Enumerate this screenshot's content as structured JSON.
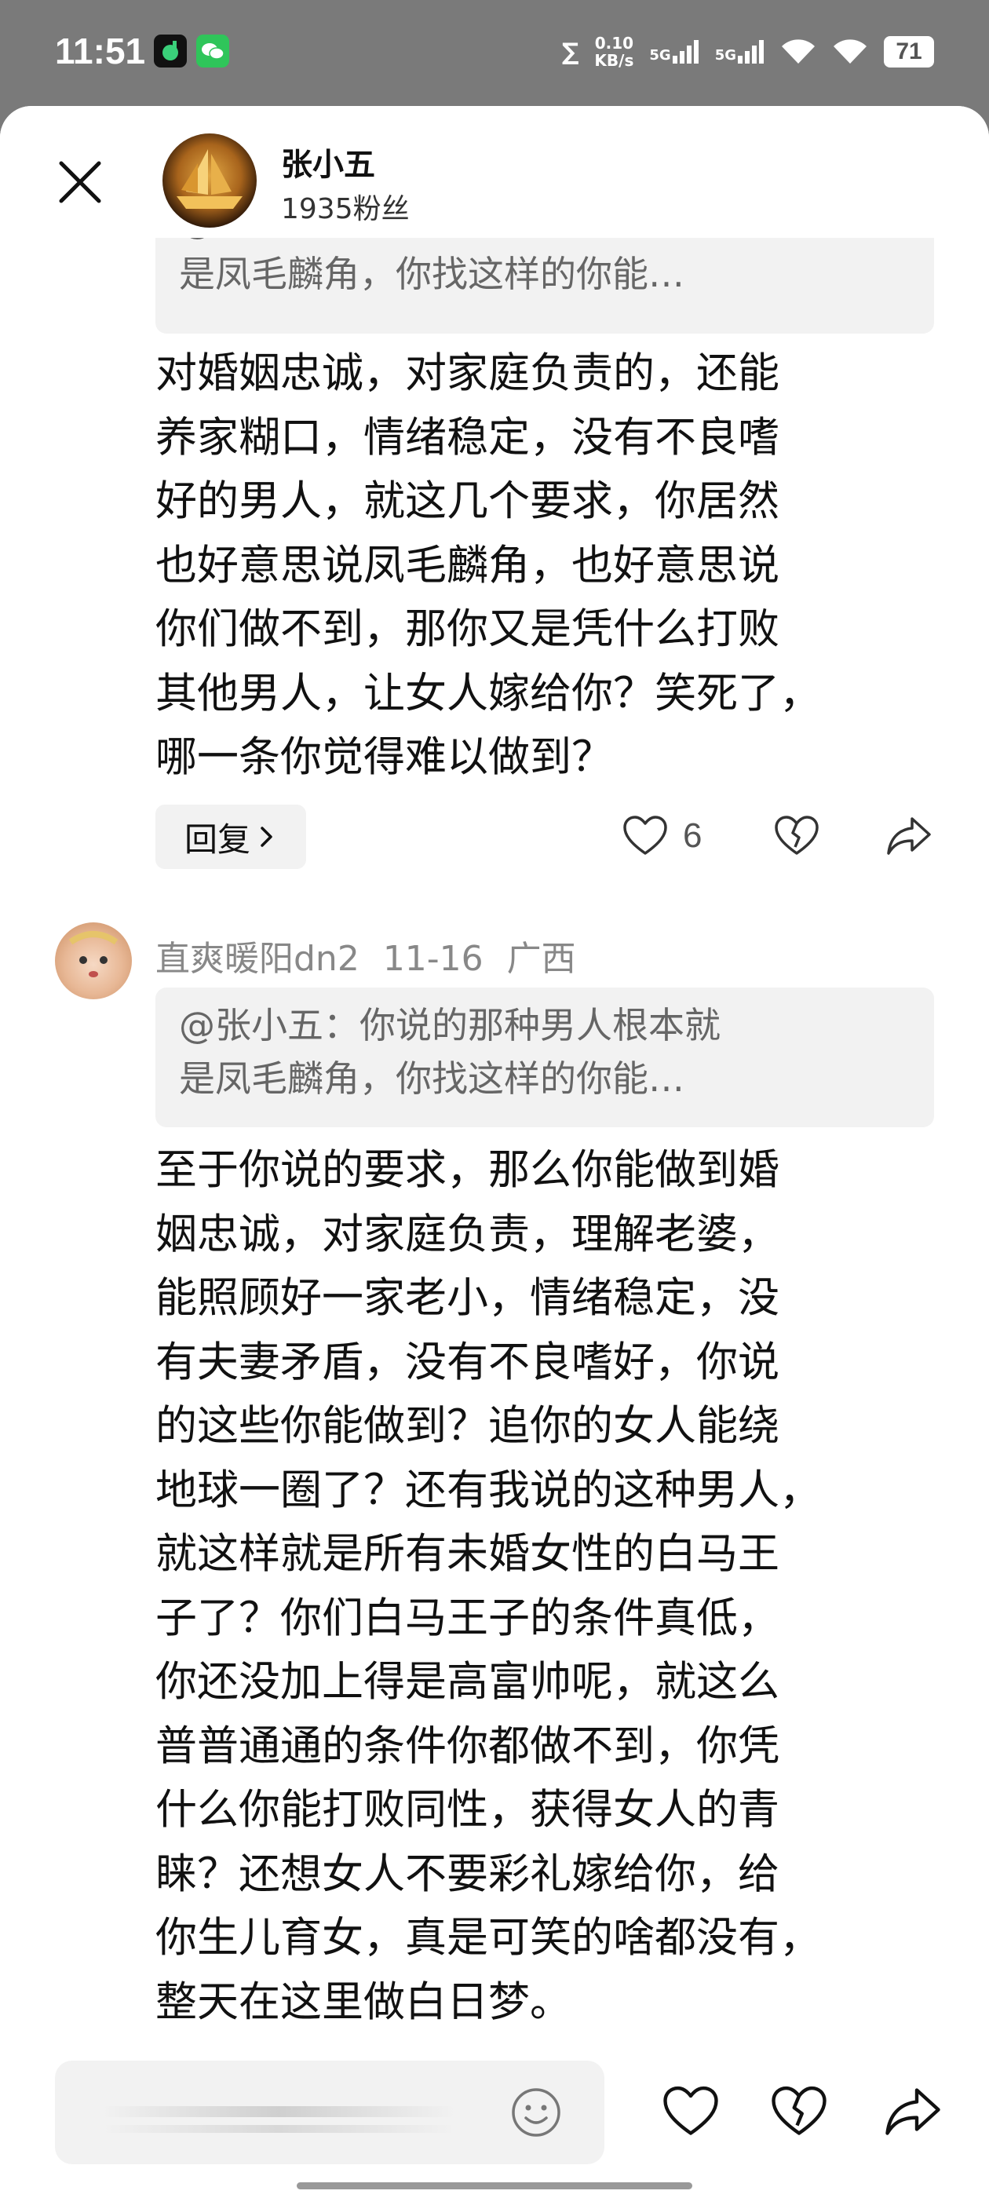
{
  "status_bar": {
    "time": "11:51",
    "net_speed_value": "0.10",
    "net_speed_unit": "KB/s",
    "signal_1": "5G",
    "signal_2": "5G",
    "battery": "71"
  },
  "header": {
    "author_name": "张小五",
    "author_fans": "1935粉丝"
  },
  "comment1": {
    "quote_line1": "@张小五：你说的那种男人根本就",
    "quote_line2": "是凤毛麟角，你找这样的你能…",
    "lines": [
      "对婚姻忠诚，对家庭负责的，还能",
      "养家糊口，情绪稳定，没有不良嗜",
      "好的男人，就这几个要求，你居然",
      "也好意思说凤毛麟角，也好意思说",
      "你们做不到，那你又是凭什么打败",
      "其他男人，让女人嫁给你？笑死了，",
      "哪一条你觉得难以做到？"
    ],
    "reply_label": "回复",
    "like_count": "6"
  },
  "comment2": {
    "username": "直爽暖阳dn2",
    "date": "11-16",
    "location": "广西",
    "quote_line1": "@张小五：你说的那种男人根本就",
    "quote_line2": "是凤毛麟角，你找这样的你能…",
    "lines": [
      "至于你说的要求，那么你能做到婚",
      "姻忠诚，对家庭负责，理解老婆，",
      "能照顾好一家老小，情绪稳定，没",
      "有夫妻矛盾，没有不良嗜好，你说",
      "的这些你能做到？追你的女人能绕",
      "地球一圈了？还有我说的这种男人，",
      "就这样就是所有未婚女性的白马王",
      "子了？你们白马王子的条件真低，",
      "你还没加上得是高富帅呢，就这么",
      "普普通通的条件你都做不到，你凭",
      "什么你能打败同性，获得女人的青",
      "睐？还想女人不要彩礼嫁给你，给",
      "你生儿育女，真是可笑的啥都没有，",
      "整天在这里做白日梦。"
    ]
  },
  "icons": {
    "close": "close-icon",
    "like": "heart-icon",
    "dislike": "broken-heart-icon",
    "share": "share-arrow-icon",
    "emoji": "smiley-icon"
  },
  "colors": {
    "status_bg": "#7a7a7a",
    "sheet_bg": "#ffffff",
    "quote_bg": "#f2f2f2",
    "meta_text": "#888888"
  }
}
